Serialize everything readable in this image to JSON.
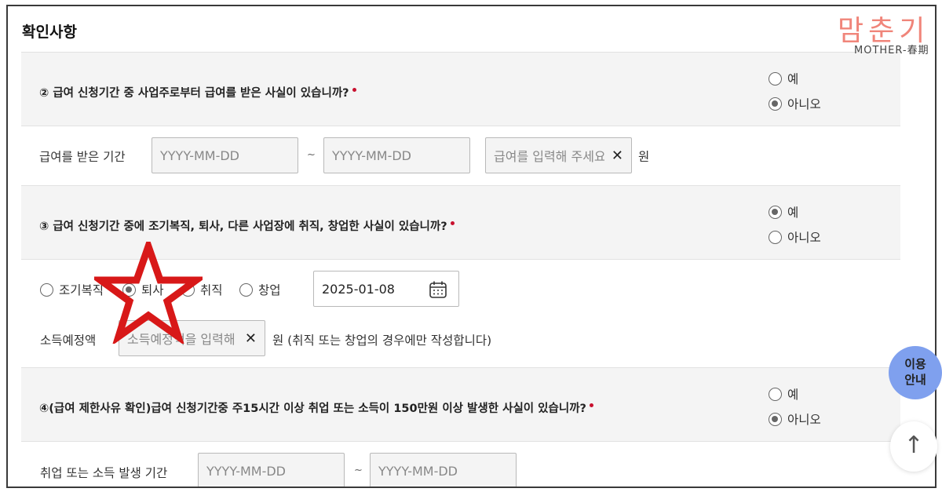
{
  "section_title": "확인사항",
  "logo": {
    "main": "맘춘기",
    "sub": "MOTHER-春期"
  },
  "q2": {
    "text": "② 급여 신청기간 중 사업주로부터 급여를 받은 사실이 있습니까?",
    "options": [
      "예",
      "아니오"
    ],
    "selected": "아니오"
  },
  "wage": {
    "label": "급여를 받은 기간",
    "from_placeholder": "YYYY-MM-DD",
    "tilde": "~",
    "to_placeholder": "YYYY-MM-DD",
    "amount_placeholder": "급여를 입력해 주세요",
    "unit": "원"
  },
  "q3": {
    "text": "③ 급여 신청기간 중에 조기복직, 퇴사, 다른 사업장에 취직, 창업한 사실이 있습니까?",
    "options": [
      "예",
      "아니오"
    ],
    "selected": "예"
  },
  "event": {
    "options": [
      "조기복직",
      "퇴사",
      "취직",
      "창업"
    ],
    "selected": "퇴사",
    "date_value": "2025-01-08"
  },
  "income": {
    "label": "소득예정액",
    "placeholder": "소득예정액을 입력해",
    "note": "원 (취직 또는 창업의 경우에만 작성합니다)"
  },
  "q4": {
    "text": "④(급여 제한사유 확인)급여 신청기간중 주15시간 이상 취업 또는 소득이 150만원 이상 발생한 사실이 있습니까?",
    "options": [
      "예",
      "아니오"
    ],
    "selected": "아니오"
  },
  "employ": {
    "label": "취업 또는 소득 발생 기간",
    "from_placeholder": "YYYY-MM-DD",
    "tilde": "~",
    "to_placeholder": "YYYY-MM-DD"
  },
  "help_button": {
    "line1": "이용",
    "line2": "안내"
  },
  "top_button": "↑",
  "colors": {
    "required": "#c8102e",
    "help": "#7fa0ee",
    "highlight_star": "#d81818",
    "logo": "#f0857a"
  }
}
